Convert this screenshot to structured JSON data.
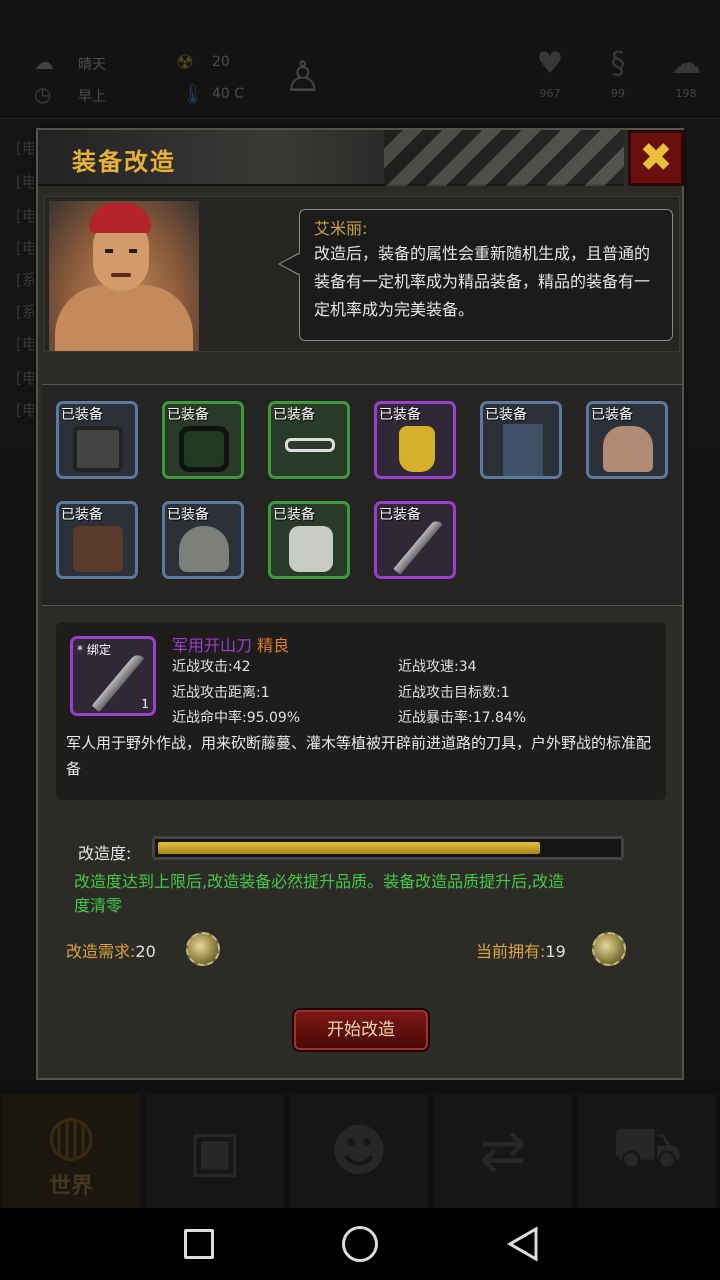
{
  "status": {
    "weather": "晴天",
    "time_of_day": "早上",
    "radiation": "20",
    "temperature": "40 C",
    "health": "967",
    "stomach": "99",
    "mind": "198"
  },
  "background_log": [
    "[电",
    "[电",
    "[电",
    "[电",
    "[系",
    "[系",
    "[电",
    "[电",
    "[电"
  ],
  "modal": {
    "title": "装备改造",
    "npc": {
      "speaker": "艾米丽:",
      "speech": "改造后，装备的属性会重新随机生成，且普通的装备有一定机率成为精品装备，精品的装备有一定机率成为完美装备。"
    },
    "equip_slots": [
      {
        "tag": "已装备",
        "rarity": "blue",
        "icon": "gloves-icon"
      },
      {
        "tag": "已装备",
        "rarity": "green",
        "icon": "goggles-icon"
      },
      {
        "tag": "已装备",
        "rarity": "green",
        "icon": "glasses-icon"
      },
      {
        "tag": "已装备",
        "rarity": "purple",
        "icon": "boots-icon"
      },
      {
        "tag": "已装备",
        "rarity": "blue",
        "icon": "jeans-icon"
      },
      {
        "tag": "已装备",
        "rarity": "blue",
        "icon": "torso-icon"
      },
      {
        "tag": "已装备",
        "rarity": "blue",
        "icon": "coat-icon"
      },
      {
        "tag": "已装备",
        "rarity": "blue",
        "icon": "helmet-icon"
      },
      {
        "tag": "已装备",
        "rarity": "green",
        "icon": "armguard-icon"
      },
      {
        "tag": "已装备",
        "rarity": "purple",
        "icon": "machete-icon"
      }
    ],
    "selected_item": {
      "bind_tag": "* 绑定",
      "qty": "1",
      "name": "军用开山刀",
      "quality": "精良",
      "stats": [
        "近战攻击:42",
        "近战攻速:34",
        "近战攻击距离:1",
        "近战攻击目标数:1",
        "近战命中率:95.09%",
        "近战暴击率:17.84%"
      ],
      "description": "军人用于野外作战，用来砍断藤蔓、灌木等植被开辟前进道路的刀具，户外野战的标准配备"
    },
    "progress": {
      "label": "改造度:",
      "fraction": 0.83
    },
    "hint": "改造度达到上限后,改造装备必然提升品质。装备改造品质提升后,改造度清零",
    "cost": {
      "label": "改造需求:",
      "value": "20"
    },
    "owned": {
      "label": "当前拥有:",
      "value": "19"
    },
    "start_button": "开始改造"
  },
  "bottom_nav": {
    "active_label": "世界"
  },
  "colors": {
    "title_gold": "#e8b23a",
    "rarity_blue": "#5a7aa0",
    "rarity_green": "#3c9a3c",
    "rarity_purple": "#9b3ecb",
    "quality_orange": "#e07e24",
    "hint_green": "#44c944"
  }
}
